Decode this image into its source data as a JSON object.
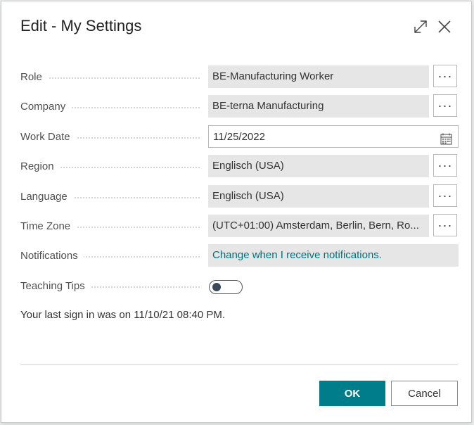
{
  "dialog": {
    "title": "Edit - My Settings",
    "expand_icon": "expand-arrows-icon",
    "close_icon": "close-icon"
  },
  "fields": {
    "role": {
      "label": "Role",
      "value": "BE-Manufacturing Worker"
    },
    "company": {
      "label": "Company",
      "value": "BE-terna Manufacturing"
    },
    "work_date": {
      "label": "Work Date",
      "value": "11/25/2022"
    },
    "region": {
      "label": "Region",
      "value": "Englisch (USA)"
    },
    "language": {
      "label": "Language",
      "value": "Englisch (USA)"
    },
    "time_zone": {
      "label": "Time Zone",
      "value": "(UTC+01:00) Amsterdam, Berlin, Bern, Ro..."
    },
    "notifications": {
      "label": "Notifications",
      "value": "Change when I receive notifications."
    },
    "teaching_tips": {
      "label": "Teaching Tips",
      "enabled": false
    }
  },
  "ellipsis": "···",
  "last_sign_in": "Your last sign in was on 11/10/21 08:40 PM.",
  "buttons": {
    "ok": "OK",
    "cancel": "Cancel"
  },
  "colors": {
    "accent": "#007d8a",
    "link": "#00707a"
  }
}
